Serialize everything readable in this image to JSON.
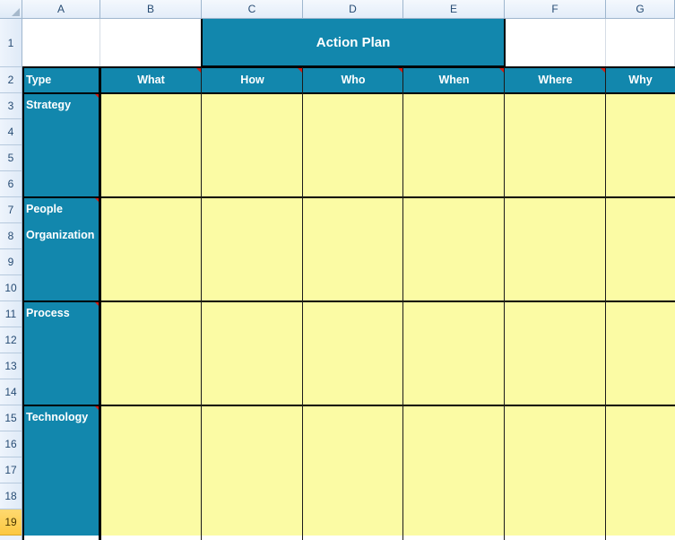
{
  "spreadsheet": {
    "select_all_label": "",
    "column_headers": [
      "A",
      "B",
      "C",
      "D",
      "E",
      "F",
      "G"
    ],
    "row_headers": [
      "1",
      "2",
      "3",
      "4",
      "5",
      "6",
      "7",
      "8",
      "9",
      "10",
      "11",
      "12",
      "13",
      "14",
      "15",
      "16",
      "17",
      "18",
      "19"
    ],
    "active_row": "19",
    "colors": {
      "header_teal": "#1287ad",
      "data_yellow": "#fbfba4",
      "comment_marker": "#d61d13",
      "row_header_active": "#fcc841",
      "heading_text": "#ffffff",
      "grid_header_text": "#264b73"
    }
  },
  "title_banner": {
    "text": "Action Plan",
    "merged_range": "C1:E1"
  },
  "table": {
    "headers": [
      {
        "label": "Type",
        "column": "A",
        "align": "left",
        "has_comment": false
      },
      {
        "label": "What",
        "column": "B",
        "align": "center",
        "has_comment": true
      },
      {
        "label": "How",
        "column": "C",
        "align": "center",
        "has_comment": true
      },
      {
        "label": "Who",
        "column": "D",
        "align": "center",
        "has_comment": true
      },
      {
        "label": "When",
        "column": "E",
        "align": "center",
        "has_comment": true
      },
      {
        "label": "Where",
        "column": "F",
        "align": "center",
        "has_comment": true
      },
      {
        "label": "Why",
        "column": "G",
        "align": "center",
        "has_comment": false
      }
    ],
    "groups": [
      {
        "labels": [
          "Strategy"
        ],
        "rows": [
          "3",
          "4",
          "5",
          "6"
        ],
        "has_comment": true,
        "cells": {
          "What": "",
          "How": "",
          "Who": "",
          "When": "",
          "Where": "",
          "Why": ""
        }
      },
      {
        "labels": [
          "People",
          "Organization"
        ],
        "rows": [
          "7",
          "8",
          "9",
          "10"
        ],
        "has_comment": true,
        "cells": {
          "What": "",
          "How": "",
          "Who": "",
          "When": "",
          "Where": "",
          "Why": ""
        }
      },
      {
        "labels": [
          "Process"
        ],
        "rows": [
          "11",
          "12",
          "13",
          "14"
        ],
        "has_comment": true,
        "cells": {
          "What": "",
          "How": "",
          "Who": "",
          "When": "",
          "Where": "",
          "Why": ""
        }
      },
      {
        "labels": [
          "Technology"
        ],
        "rows": [
          "15",
          "16",
          "17",
          "18",
          "19"
        ],
        "has_comment": true,
        "cells": {
          "What": "",
          "How": "",
          "Who": "",
          "When": "",
          "Where": "",
          "Why": ""
        }
      }
    ]
  }
}
